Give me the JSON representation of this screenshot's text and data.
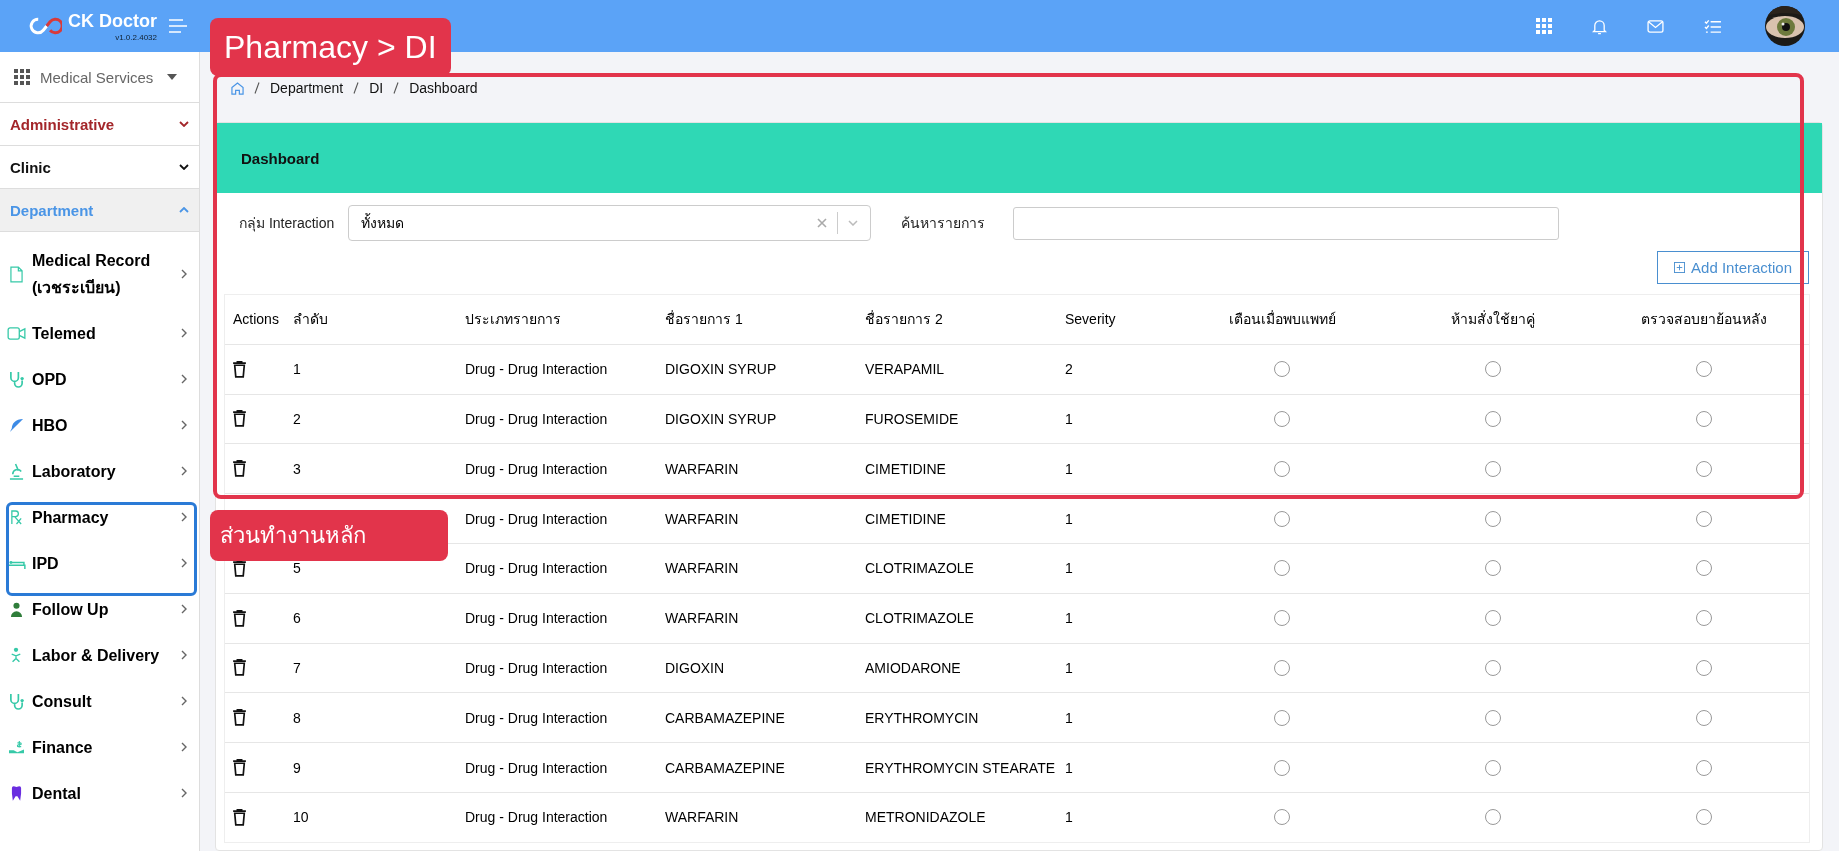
{
  "app": {
    "name": "CK Doctor",
    "version": "v1.0.2.4032"
  },
  "sidebar": {
    "menu": "Medical Services",
    "sections": [
      {
        "label": "Administrative",
        "kind": "admin",
        "expanded": false
      },
      {
        "label": "Clinic",
        "kind": "plain",
        "expanded": false
      },
      {
        "label": "Department",
        "kind": "active",
        "expanded": true
      }
    ],
    "items": [
      {
        "label": "Medical Record (เวชระเบียน)"
      },
      {
        "label": "Telemed"
      },
      {
        "label": "OPD"
      },
      {
        "label": "HBO"
      },
      {
        "label": "Laboratory"
      },
      {
        "label": "Pharmacy"
      },
      {
        "label": "IPD"
      },
      {
        "label": "Follow Up"
      },
      {
        "label": "Labor & Delivery"
      },
      {
        "label": "Consult"
      },
      {
        "label": "Finance"
      },
      {
        "label": "Dental"
      }
    ]
  },
  "breadcrumb": [
    "Department",
    "DI",
    "Dashboard"
  ],
  "panel": {
    "title": "Dashboard",
    "filters": {
      "group_label": "กลุ่ม Interaction",
      "group_value": "ทั้งหมด",
      "search_label": "ค้นหารายการ"
    },
    "add_button": "Add Interaction",
    "table": {
      "columns": [
        "Actions",
        "ลำดับ",
        "ประเภทรายการ",
        "ชื่อรายการ 1",
        "ชื่อรายการ 2",
        "Severity",
        "เตือนเมื่อพบแพทย์",
        "ห้ามสั่งใช้ยาคู่",
        "ตรวจสอบยาย้อนหลัง"
      ],
      "rows": [
        {
          "no": "1",
          "type": "Drug - Drug Interaction",
          "item1": "DIGOXIN SYRUP",
          "item2": "VERAPAMIL",
          "severity": "2",
          "warn": false,
          "forbid": false,
          "recheck": false
        },
        {
          "no": "2",
          "type": "Drug - Drug Interaction",
          "item1": "DIGOXIN SYRUP",
          "item2": "FUROSEMIDE",
          "severity": "1",
          "warn": false,
          "forbid": false,
          "recheck": false
        },
        {
          "no": "3",
          "type": "Drug - Drug Interaction",
          "item1": "WARFARIN",
          "item2": "CIMETIDINE",
          "severity": "1",
          "warn": false,
          "forbid": false,
          "recheck": false
        },
        {
          "type": "Drug - Drug Interaction",
          "item1": "WARFARIN",
          "item2": "CIMETIDINE",
          "severity": "1",
          "warn": false,
          "forbid": false,
          "recheck": false
        },
        {
          "no": "5",
          "type": "Drug - Drug Interaction",
          "item1": "WARFARIN",
          "item2": "CLOTRIMAZOLE",
          "severity": "1",
          "warn": false,
          "forbid": false,
          "recheck": false
        },
        {
          "no": "6",
          "type": "Drug - Drug Interaction",
          "item1": "WARFARIN",
          "item2": "CLOTRIMAZOLE",
          "severity": "1",
          "warn": false,
          "forbid": false,
          "recheck": false
        },
        {
          "no": "7",
          "type": "Drug - Drug Interaction",
          "item1": "DIGOXIN",
          "item2": "AMIODARONE",
          "severity": "1",
          "warn": false,
          "forbid": false,
          "recheck": false
        },
        {
          "no": "8",
          "type": "Drug - Drug Interaction",
          "item1": "CARBAMAZEPINE",
          "item2": "ERYTHROMYCIN",
          "severity": "1",
          "warn": false,
          "forbid": false,
          "recheck": false
        },
        {
          "no": "9",
          "type": "Drug - Drug Interaction",
          "item1": "CARBAMAZEPINE",
          "item2": "ERYTHROMYCIN STEARATE",
          "severity": "1",
          "warn": false,
          "forbid": false,
          "recheck": false
        },
        {
          "no": "10",
          "type": "Drug - Drug Interaction",
          "item1": "WARFARIN",
          "item2": "METRONIDAZOLE",
          "severity": "1",
          "warn": false,
          "forbid": false,
          "recheck": false
        }
      ]
    }
  },
  "annotations": [
    {
      "label": "Pharmacy > DI",
      "kind": "red"
    },
    {
      "label": "ส่วนทำงานหลัก",
      "kind": "red-small"
    }
  ]
}
